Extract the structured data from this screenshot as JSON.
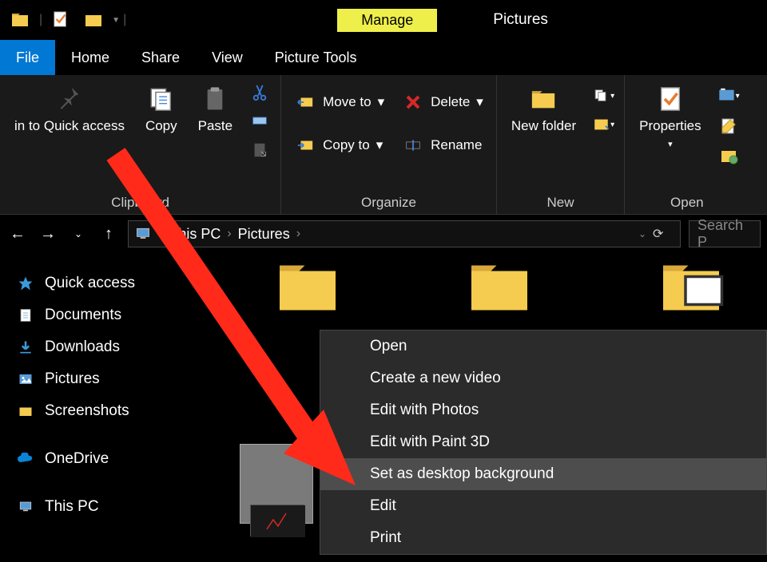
{
  "titlebar": {
    "manage_label": "Manage",
    "title": "Pictures"
  },
  "menu": {
    "file": "File",
    "home": "Home",
    "share": "Share",
    "view": "View",
    "picture_tools": "Picture Tools"
  },
  "ribbon": {
    "pin_label": "in to Quick access",
    "copy_label": "Copy",
    "paste_label": "Paste",
    "clipboard_group": "Clipboard",
    "move_to": "Move to",
    "copy_to": "Copy to",
    "delete": "Delete",
    "rename": "Rename",
    "organize_group": "Organize",
    "new_folder": "New folder",
    "new_group": "New",
    "properties": "Properties",
    "open_group": "Open"
  },
  "breadcrumb": {
    "root": "This PC",
    "folder": "Pictures"
  },
  "search": {
    "placeholder": "Search P"
  },
  "nav": {
    "quick_access": "Quick access",
    "documents": "Documents",
    "downloads": "Downloads",
    "pictures": "Pictures",
    "screenshots": "Screenshots",
    "onedrive": "OneDrive",
    "this_pc": "This PC"
  },
  "context_menu": {
    "items": [
      {
        "label": "Open",
        "highlighted": false
      },
      {
        "label": "Create a new video",
        "highlighted": false
      },
      {
        "label": "Edit with Photos",
        "highlighted": false
      },
      {
        "label": "Edit with Paint 3D",
        "highlighted": false
      },
      {
        "label": "Set as desktop background",
        "highlighted": true
      },
      {
        "label": "Edit",
        "highlighted": false
      },
      {
        "label": "Print",
        "highlighted": false
      }
    ]
  },
  "colors": {
    "accent": "#0078d4",
    "highlight": "#efef4b",
    "arrow": "#ff2a1a"
  }
}
